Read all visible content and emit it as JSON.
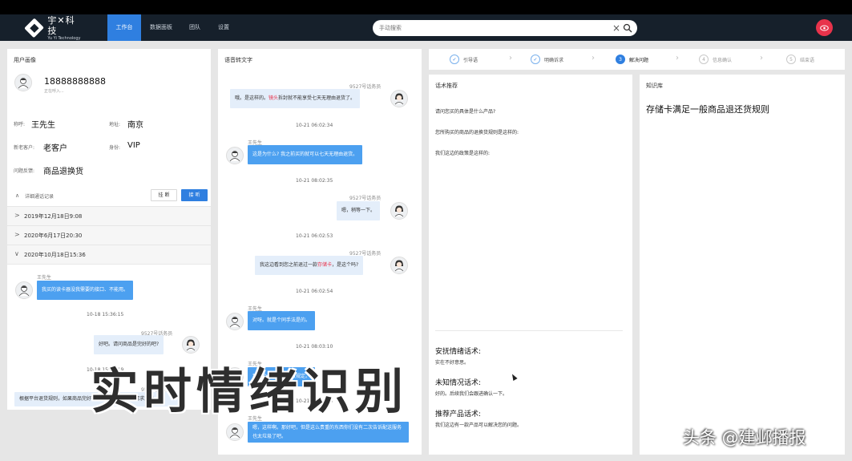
{
  "logo": {
    "cn": "宇✕科技",
    "en": "Yu Yi Technology"
  },
  "nav": [
    {
      "label": "工作台",
      "active": true
    },
    {
      "label": "数据面板",
      "active": false
    },
    {
      "label": "团队",
      "active": false
    },
    {
      "label": "设置",
      "active": false
    }
  ],
  "search": {
    "placeholder": "手动搜索"
  },
  "left": {
    "title": "用户画像",
    "phone": "18888888888",
    "status": "正在呼入...",
    "fields": {
      "name_label": "称呼:",
      "name_value": "王先生",
      "addr_label": "地址:",
      "addr_value": "南京",
      "type_label": "新老客户:",
      "type_value": "老客户",
      "id_label": "身份:",
      "id_value": "VIP",
      "feedback_label": "问题反馈:",
      "feedback_value": "商品退换货"
    },
    "history_toggle": "详细通话记录",
    "hangup": "挂 断",
    "answer": "接 听",
    "records": [
      {
        "chev": ">",
        "text": "2019年12月18日9:08"
      },
      {
        "chev": ">",
        "text": "2020年6月17日20:30"
      },
      {
        "chev": "∨",
        "text": "2020年10月18日15:36"
      }
    ],
    "chat": {
      "speaker1": "王先生",
      "msg1": "我买的读卡器没我需要的接口、不能用。",
      "ts1": "10-18 15:36:15",
      "speaker2": "9527号话务员",
      "msg2": "好吧。请问商品是完好的吧?",
      "ts2": "10-18 15:36:19",
      "speaker3": "9527号话务员",
      "msg3": "根据平台退货规则，如果商品完好的话，我们会拒绝的请求退货。"
    }
  },
  "mid": {
    "title": "语音转文字",
    "chat": [
      {
        "speaker": "9527号话务员",
        "pre": "哦。是这样的。",
        "hl": "镜头",
        "post": "拆封就不能享受七天无理由退货了。",
        "ts": "10-21 06:02:34"
      },
      {
        "speaker": "王先生",
        "text": "这是为什么? 我之前买的就可以七天无理由退货。",
        "ts": "10-21 08:02:35"
      },
      {
        "speaker": "9527号话务员",
        "text": "嗯，稍等一下。",
        "ts": "10-21 06:02:53"
      },
      {
        "speaker": "9527号话务员",
        "pre": "我这边看到您之前退过一款",
        "hl": "存储卡",
        "post": "，是这个吗?",
        "ts": "10-21 06:02:54"
      },
      {
        "speaker": "王先生",
        "text": "对呀。就是个同手法是的。",
        "ts": "10-21 08:03:10"
      },
      {
        "speaker": "王先生",
        "text": "那为什么就可以退货规定。",
        "ts": "10-21 06:03:25"
      },
      {
        "speaker": "王先生",
        "text": "嗯，这样啊。那好吧，但是这么贵重的东西你们没有二次告诉配送服务也太垃圾了吧。"
      }
    ]
  },
  "steps": [
    {
      "icon": "✓",
      "label": "引导语",
      "state": "done"
    },
    {
      "icon": "✓",
      "label": "明确诉求",
      "state": "done"
    },
    {
      "icon": "3",
      "label": "解决问题",
      "state": "current"
    },
    {
      "icon": "4",
      "label": "信息确认",
      "state": "todo"
    },
    {
      "icon": "5",
      "label": "结束语",
      "state": "todo"
    }
  ],
  "scripts": {
    "title": "话术推荐",
    "lines": [
      "请问您买的具体是什么产品?",
      "您所购买的商品的退换货规则是这样的:",
      "我们这边的政策是这样的:"
    ],
    "sec1_title": "安抚情绪话术:",
    "sec1_text": "实在不好意思。",
    "sec2_title": "未知情况话术:",
    "sec2_text": "好的。后续我们会跟进确认一下。",
    "sec3_title": "推荐产品话术:",
    "sec3_text": "我们这边有一款产品可以解决您的问题。"
  },
  "kb": {
    "title": "知识库",
    "headline": "存储卡满足一般商品退还货规则"
  },
  "overlay": {
    "caption": "实时情绪识别",
    "credit": "头条 @建邺播报"
  },
  "colors": {
    "accent": "#2f7fe0",
    "nav_bg": "#16202b",
    "highlight": "#e8334b",
    "bubble_in": "#4ca0f0",
    "bubble_out": "#e4eefa"
  }
}
